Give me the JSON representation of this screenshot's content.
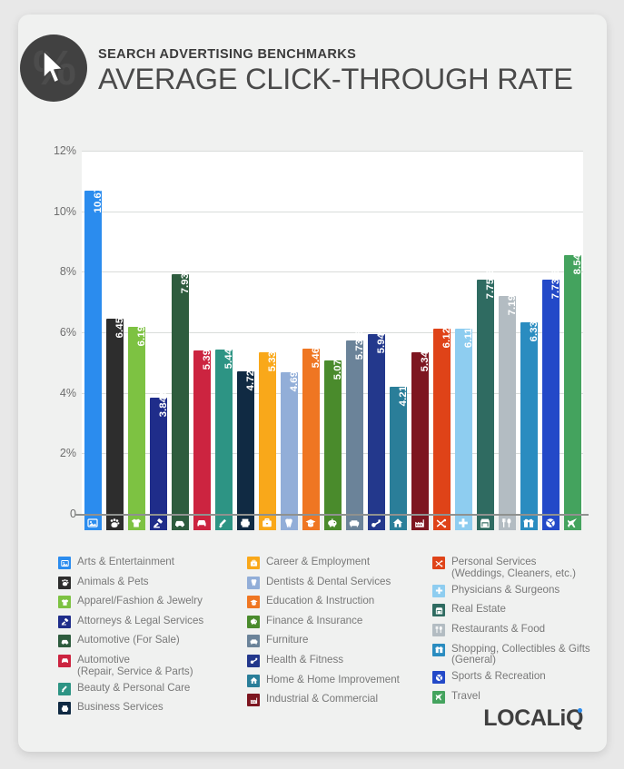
{
  "header": {
    "kicker": "SEARCH ADVERTISING BENCHMARKS",
    "title": "AVERAGE CLICK-THROUGH RATE",
    "logo_icon": "percent-cursor-icon"
  },
  "brand": {
    "name": "LOCALiQ",
    "dot_color": "#2b8cee"
  },
  "chart_data": {
    "type": "bar",
    "title": "AVERAGE CLICK-THROUGH RATE",
    "subtitle": "SEARCH ADVERTISING BENCHMARKS",
    "xlabel": "",
    "ylabel": "",
    "ylim": [
      0,
      12
    ],
    "grid": true,
    "legend_position": "below",
    "value_suffix": "%",
    "ytick_labels": [
      "0",
      "2%",
      "4%",
      "6%",
      "8%",
      "10%",
      "12%"
    ],
    "ytick_values": [
      0,
      2,
      4,
      6,
      8,
      10,
      12
    ],
    "categories": [
      "Arts & Entertainment",
      "Animals & Pets",
      "Apparel/Fashion & Jewelry",
      "Attorneys & Legal Services",
      "Automotive (For Sale)",
      "Automotive (Repair, Service & Parts)",
      "Beauty & Personal Care",
      "Business Services",
      "Career & Employment",
      "Dentists & Dental Services",
      "Education & Instruction",
      "Finance & Insurance",
      "Furniture",
      "Health & Fitness",
      "Home & Home Improvement",
      "Industrial & Commercial",
      "Personal Services (Weddings, Cleaners, etc.)",
      "Physicians & Surgeons",
      "Real Estate",
      "Restaurants & Food",
      "Shopping, Collectibles & Gifts (General)",
      "Sports & Recreation",
      "Travel"
    ],
    "values": [
      10.67,
      6.45,
      6.19,
      3.84,
      7.93,
      5.39,
      5.44,
      4.72,
      5.33,
      4.69,
      5.46,
      5.07,
      5.73,
      5.94,
      4.21,
      5.34,
      6.12,
      6.11,
      7.75,
      7.19,
      6.33,
      7.73,
      8.54
    ],
    "labels": [
      "10.67%",
      "6.45%",
      "6.19%",
      "3.84%",
      "7.93%",
      "5.39%",
      "5.44%",
      "4.72%",
      "5.33%",
      "4.69%",
      "5.46%",
      "5.07%",
      "5.73%",
      "5.94%",
      "4.21%",
      "5.34%",
      "6.12%",
      "6.11%",
      "7.75%",
      "7.19%",
      "6.33%",
      "7.73%",
      "8.54%"
    ],
    "colors": [
      "#2b8cee",
      "#2d2d2d",
      "#7dc242",
      "#1f2d8a",
      "#2e5c3e",
      "#cc2440",
      "#2d9484",
      "#102a43",
      "#f9a81a",
      "#92aed8",
      "#ef7622",
      "#4a8b2c",
      "#6b8399",
      "#23388c",
      "#2a7e99",
      "#7d1620",
      "#df4318",
      "#8ecdf0",
      "#2f6b61",
      "#b3bcc2",
      "#2a8cc0",
      "#2349c8",
      "#44a35e"
    ],
    "label_colors": [
      "#ffffff",
      "#ffffff",
      "#ffffff",
      "#ffffff",
      "#ffffff",
      "#ffffff",
      "#ffffff",
      "#ffffff",
      "#ffffff",
      "#ffffff",
      "#ffffff",
      "#ffffff",
      "#ffffff",
      "#ffffff",
      "#ffffff",
      "#ffffff",
      "#ffffff",
      "#ffffff",
      "#ffffff",
      "#ffffff",
      "#ffffff",
      "#ffffff",
      "#ffffff"
    ],
    "icons": [
      "picture-icon",
      "paw-icon",
      "tshirt-icon",
      "gavel-icon",
      "car-side-icon",
      "car-front-icon",
      "brush-icon",
      "printer-icon",
      "briefcase-icon",
      "tooth-icon",
      "graduation-cap-icon",
      "piggy-bank-icon",
      "sofa-icon",
      "dumbbell-icon",
      "house-icon",
      "factory-icon",
      "ribbon-scissors-icon",
      "medical-cross-icon",
      "storefront-icon",
      "cutlery-icon",
      "gift-bow-icon",
      "ball-icon",
      "airplane-icon"
    ]
  },
  "legend": {
    "columns": [
      {
        "items": [
          {
            "label": "Arts & Entertainment",
            "color": "#2b8cee",
            "icon": "picture-icon"
          },
          {
            "label": "Animals & Pets",
            "color": "#2d2d2d",
            "icon": "paw-icon"
          },
          {
            "label": "Apparel/Fashion & Jewelry",
            "color": "#7dc242",
            "icon": "tshirt-icon"
          },
          {
            "label": "Attorneys & Legal Services",
            "color": "#1f2d8a",
            "icon": "gavel-icon"
          },
          {
            "label": "Automotive (For Sale)",
            "color": "#2e5c3e",
            "icon": "car-side-icon"
          },
          {
            "label": "Automotive\n(Repair, Service & Parts)",
            "color": "#cc2440",
            "icon": "car-front-icon"
          },
          {
            "label": "Beauty & Personal Care",
            "color": "#2d9484",
            "icon": "brush-icon"
          },
          {
            "label": "Business Services",
            "color": "#102a43",
            "icon": "printer-icon"
          }
        ]
      },
      {
        "items": [
          {
            "label": "Career & Employment",
            "color": "#f9a81a",
            "icon": "briefcase-icon"
          },
          {
            "label": "Dentists & Dental Services",
            "color": "#92aed8",
            "icon": "tooth-icon"
          },
          {
            "label": "Education & Instruction",
            "color": "#ef7622",
            "icon": "graduation-cap-icon"
          },
          {
            "label": "Finance & Insurance",
            "color": "#4a8b2c",
            "icon": "piggy-bank-icon"
          },
          {
            "label": "Furniture",
            "color": "#6b8399",
            "icon": "sofa-icon"
          },
          {
            "label": "Health & Fitness",
            "color": "#23388c",
            "icon": "dumbbell-icon"
          },
          {
            "label": "Home & Home Improvement",
            "color": "#2a7e99",
            "icon": "house-icon"
          },
          {
            "label": "Industrial & Commercial",
            "color": "#7d1620",
            "icon": "factory-icon"
          }
        ]
      },
      {
        "items": [
          {
            "label": "Personal Services\n(Weddings, Cleaners, etc.)",
            "color": "#df4318",
            "icon": "ribbon-scissors-icon"
          },
          {
            "label": "Physicians & Surgeons",
            "color": "#8ecdf0",
            "icon": "medical-cross-icon"
          },
          {
            "label": "Real Estate",
            "color": "#2f6b61",
            "icon": "storefront-icon"
          },
          {
            "label": "Restaurants & Food",
            "color": "#b3bcc2",
            "icon": "cutlery-icon"
          },
          {
            "label": "Shopping, Collectibles & Gifts\n(General)",
            "color": "#2a8cc0",
            "icon": "gift-bow-icon"
          },
          {
            "label": "Sports & Recreation",
            "color": "#2349c8",
            "icon": "ball-icon"
          },
          {
            "label": "Travel",
            "color": "#44a35e",
            "icon": "airplane-icon"
          }
        ]
      }
    ]
  }
}
